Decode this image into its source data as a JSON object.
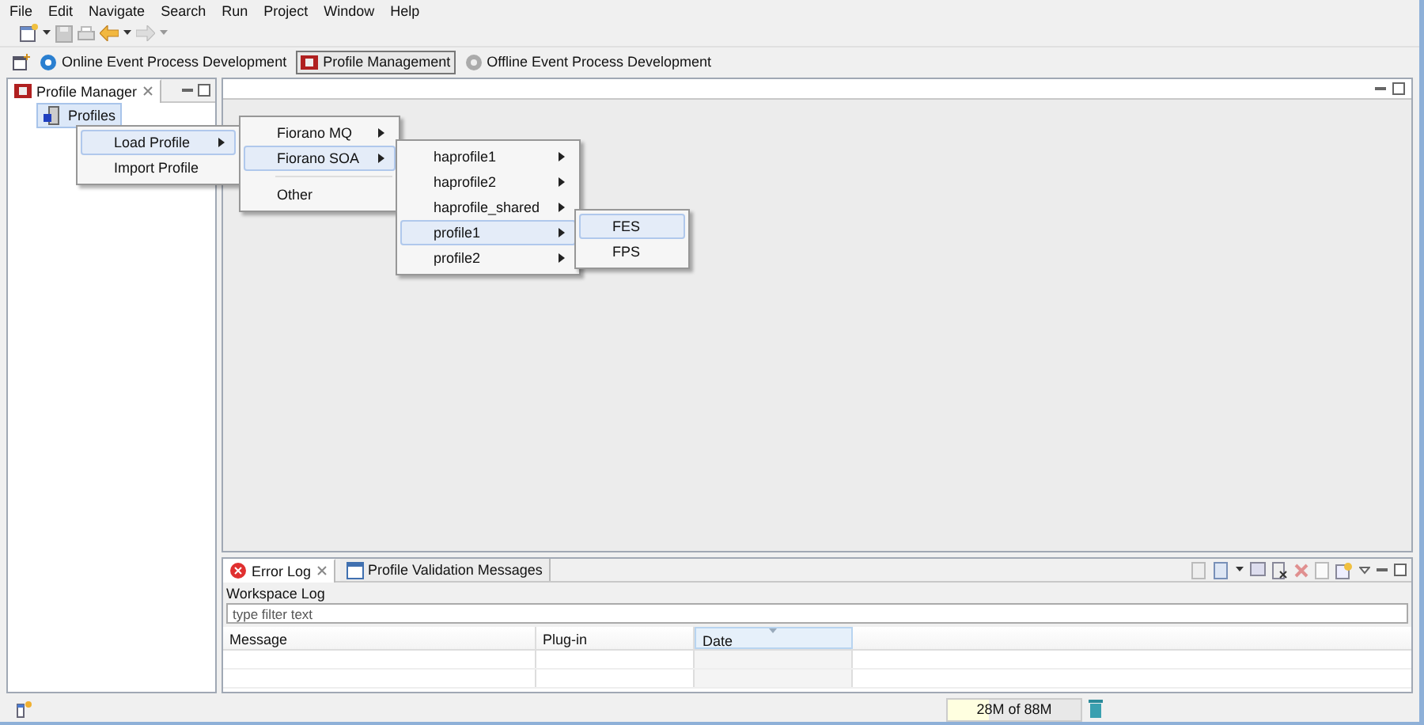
{
  "menu_bar": [
    "File",
    "Edit",
    "Navigate",
    "Search",
    "Run",
    "Project",
    "Window",
    "Help"
  ],
  "perspectives": [
    {
      "label": "Online Event Process Development",
      "selected": false,
      "kind": "online"
    },
    {
      "label": "Profile Management",
      "selected": true,
      "kind": "profile"
    },
    {
      "label": "Offline Event Process Development",
      "selected": false,
      "kind": "offline"
    }
  ],
  "profile_manager": {
    "tab": {
      "label": "Profile Manager",
      "selected": true
    },
    "tree": [
      {
        "label": "Profiles",
        "selected": true
      }
    ]
  },
  "context_menus": [
    {
      "items": [
        {
          "label": "Load Profile",
          "selected": true,
          "submenu": true,
          "kind": "item"
        },
        {
          "label": "Import Profile",
          "selected": false,
          "submenu": false,
          "kind": "item"
        }
      ]
    },
    {
      "items": [
        {
          "label": "Fiorano MQ",
          "selected": false,
          "submenu": true,
          "kind": "item"
        },
        {
          "label": "Fiorano SOA",
          "selected": true,
          "submenu": true,
          "kind": "item"
        },
        {
          "kind": "separator"
        },
        {
          "label": "Other",
          "selected": false,
          "submenu": false,
          "kind": "item"
        }
      ]
    },
    {
      "items": [
        {
          "label": "haprofile1",
          "selected": false,
          "submenu": true,
          "kind": "item"
        },
        {
          "label": "haprofile2",
          "selected": false,
          "submenu": true,
          "kind": "item"
        },
        {
          "label": "haprofile_shared",
          "selected": false,
          "submenu": true,
          "kind": "item"
        },
        {
          "label": "profile1",
          "selected": true,
          "submenu": true,
          "kind": "item"
        },
        {
          "label": "profile2",
          "selected": false,
          "submenu": true,
          "kind": "item"
        }
      ]
    },
    {
      "items": [
        {
          "label": "FES",
          "selected": true,
          "submenu": false,
          "kind": "item"
        },
        {
          "label": "FPS",
          "selected": false,
          "submenu": false,
          "kind": "item"
        }
      ]
    }
  ],
  "bottom_panel": {
    "tabs": [
      {
        "label": "Error Log",
        "selected": true,
        "kind": "error"
      },
      {
        "label": "Profile Validation Messages",
        "selected": false,
        "kind": "validation"
      }
    ],
    "title": "Workspace Log",
    "filter": {
      "placeholder": "type filter text"
    },
    "columns": [
      {
        "label": "Message",
        "sorted": false
      },
      {
        "label": "Plug-in",
        "sorted": false
      },
      {
        "label": "Date",
        "sorted": true
      }
    ]
  },
  "status_bar": {
    "memory": {
      "reading": "28M of 88M",
      "level": 0.31
    }
  }
}
